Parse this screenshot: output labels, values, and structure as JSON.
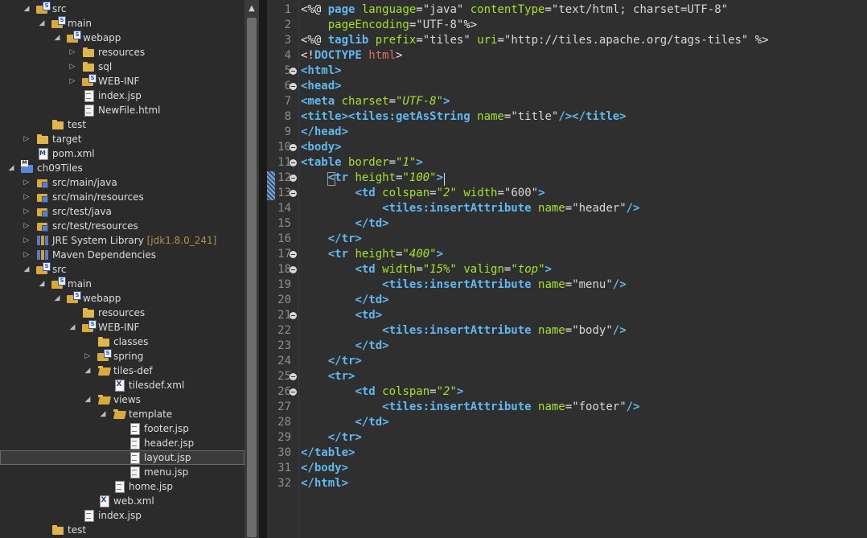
{
  "explorer": {
    "nodes": [
      {
        "label": "src",
        "depth": 1,
        "twisty": "open",
        "icon": "pkgfolder"
      },
      {
        "label": "main",
        "depth": 2,
        "twisty": "open",
        "icon": "pkgfolder"
      },
      {
        "label": "webapp",
        "depth": 3,
        "twisty": "open",
        "icon": "pkgfolder"
      },
      {
        "label": "resources",
        "depth": 4,
        "twisty": "closed",
        "icon": "folder"
      },
      {
        "label": "sql",
        "depth": 4,
        "twisty": "closed",
        "icon": "folder"
      },
      {
        "label": "WEB-INF",
        "depth": 4,
        "twisty": "closed",
        "icon": "pkgfolder"
      },
      {
        "label": "index.jsp",
        "depth": 4,
        "twisty": "none",
        "icon": "file"
      },
      {
        "label": "NewFile.html",
        "depth": 4,
        "twisty": "none",
        "icon": "file"
      },
      {
        "label": "test",
        "depth": 2,
        "twisty": "none",
        "icon": "folder"
      },
      {
        "label": "target",
        "depth": 1,
        "twisty": "closed",
        "icon": "folder"
      },
      {
        "label": "pom.xml",
        "depth": 1,
        "twisty": "none",
        "icon": "mvnfile"
      },
      {
        "label": "ch09Tiles",
        "depth": 0,
        "twisty": "open",
        "icon": "project"
      },
      {
        "label": "src/main/java",
        "depth": 1,
        "twisty": "closed",
        "icon": "srcfolder"
      },
      {
        "label": "src/main/resources",
        "depth": 1,
        "twisty": "closed",
        "icon": "srcfolder"
      },
      {
        "label": "src/test/java",
        "depth": 1,
        "twisty": "closed",
        "icon": "srcfolder"
      },
      {
        "label": "src/test/resources",
        "depth": 1,
        "twisty": "closed",
        "icon": "srcfolder"
      },
      {
        "label": "JRE System Library",
        "decoration": "[jdk1.8.0_241]",
        "depth": 1,
        "twisty": "closed",
        "icon": "jarlib"
      },
      {
        "label": "Maven Dependencies",
        "depth": 1,
        "twisty": "closed",
        "icon": "jarlib"
      },
      {
        "label": "src",
        "depth": 1,
        "twisty": "open",
        "icon": "pkgfolder"
      },
      {
        "label": "main",
        "depth": 2,
        "twisty": "open",
        "icon": "pkgfolder"
      },
      {
        "label": "webapp",
        "depth": 3,
        "twisty": "open",
        "icon": "pkgfolder"
      },
      {
        "label": "resources",
        "depth": 4,
        "twisty": "none",
        "icon": "folder"
      },
      {
        "label": "WEB-INF",
        "depth": 4,
        "twisty": "open",
        "icon": "pkgfolder"
      },
      {
        "label": "classes",
        "depth": 5,
        "twisty": "none",
        "icon": "folder"
      },
      {
        "label": "spring",
        "depth": 5,
        "twisty": "closed",
        "icon": "pkgfolder"
      },
      {
        "label": "tiles-def",
        "depth": 5,
        "twisty": "open",
        "icon": "folder"
      },
      {
        "label": "tilesdef.xml",
        "depth": 6,
        "twisty": "none",
        "icon": "xmlfile"
      },
      {
        "label": "views",
        "depth": 5,
        "twisty": "open",
        "icon": "folder"
      },
      {
        "label": "template",
        "depth": 6,
        "twisty": "open",
        "icon": "folder"
      },
      {
        "label": "footer.jsp",
        "depth": 7,
        "twisty": "none",
        "icon": "file"
      },
      {
        "label": "header.jsp",
        "depth": 7,
        "twisty": "none",
        "icon": "file"
      },
      {
        "label": "layout.jsp",
        "depth": 7,
        "twisty": "none",
        "icon": "file",
        "selected": true
      },
      {
        "label": "menu.jsp",
        "depth": 7,
        "twisty": "none",
        "icon": "file"
      },
      {
        "label": "home.jsp",
        "depth": 6,
        "twisty": "none",
        "icon": "file"
      },
      {
        "label": "web.xml",
        "depth": 5,
        "twisty": "none",
        "icon": "xmlfile"
      },
      {
        "label": "index.jsp",
        "depth": 4,
        "twisty": "none",
        "icon": "file"
      },
      {
        "label": "test",
        "depth": 2,
        "twisty": "none",
        "icon": "folder"
      }
    ]
  },
  "editor": {
    "lines": [
      {
        "n": "1",
        "fold": false,
        "tokens": [
          [
            "dir",
            "<%@ "
          ],
          [
            "tag",
            "page"
          ],
          [
            "attr",
            " language"
          ],
          [
            "punc",
            "="
          ],
          [
            "str",
            "\"java\""
          ],
          [
            "attr",
            " contentType"
          ],
          [
            "punc",
            "="
          ],
          [
            "str",
            "\"text/html; charset=UTF-8\""
          ]
        ]
      },
      {
        "n": "2",
        "fold": false,
        "tokens": [
          [
            "attr",
            "    pageEncoding"
          ],
          [
            "punc",
            "="
          ],
          [
            "str",
            "\"UTF-8\""
          ],
          [
            "pct",
            "%>"
          ]
        ]
      },
      {
        "n": "3",
        "fold": false,
        "tokens": [
          [
            "dir",
            "<%@ "
          ],
          [
            "tag",
            "taglib"
          ],
          [
            "attr",
            " prefix"
          ],
          [
            "punc",
            "="
          ],
          [
            "str",
            "\"tiles\""
          ],
          [
            "attr",
            " uri"
          ],
          [
            "punc",
            "="
          ],
          [
            "str",
            "\"http://tiles.apache.org/tags-tiles\""
          ],
          [
            "pct",
            " %>"
          ]
        ]
      },
      {
        "n": "4",
        "fold": false,
        "tokens": [
          [
            "doc",
            "<!"
          ],
          [
            "tag",
            "DOCTYPE"
          ],
          [
            "docname",
            " html"
          ],
          [
            "doc",
            ">"
          ]
        ]
      },
      {
        "n": "5",
        "fold": true,
        "tokens": [
          [
            "tag",
            "<html>"
          ]
        ]
      },
      {
        "n": "6",
        "fold": true,
        "tokens": [
          [
            "tag",
            "<head>"
          ]
        ]
      },
      {
        "n": "7",
        "fold": false,
        "tokens": [
          [
            "tag",
            "<meta"
          ],
          [
            "attr",
            " charset"
          ],
          [
            "punc",
            "="
          ],
          [
            "ival",
            "\"UTF-8\""
          ],
          [
            "tag",
            ">"
          ]
        ]
      },
      {
        "n": "8",
        "fold": false,
        "tokens": [
          [
            "tag",
            "<title><tiles:getAsString"
          ],
          [
            "attr",
            " name"
          ],
          [
            "punc",
            "="
          ],
          [
            "str",
            "\"title\""
          ],
          [
            "tag",
            "/></title>"
          ]
        ]
      },
      {
        "n": "9",
        "fold": false,
        "tokens": [
          [
            "tag",
            "</head>"
          ]
        ]
      },
      {
        "n": "10",
        "fold": true,
        "tokens": [
          [
            "tag",
            "<body>"
          ]
        ]
      },
      {
        "n": "11",
        "fold": true,
        "tokens": [
          [
            "tag",
            "<table"
          ],
          [
            "attr",
            " border"
          ],
          [
            "punc",
            "="
          ],
          [
            "ival",
            "\"1\""
          ],
          [
            "tag",
            ">"
          ]
        ]
      },
      {
        "n": "12",
        "fold": true,
        "tokens": [
          [
            "plain",
            "    "
          ],
          [
            "tag",
            "<tr"
          ],
          [
            "attr",
            " height"
          ],
          [
            "punc",
            "="
          ],
          [
            "ival",
            "\"100\""
          ],
          [
            "tag",
            ">"
          ]
        ]
      },
      {
        "n": "13",
        "fold": true,
        "tokens": [
          [
            "plain",
            "        "
          ],
          [
            "tag",
            "<td"
          ],
          [
            "attr",
            " colspan"
          ],
          [
            "punc",
            "="
          ],
          [
            "ival",
            "\"2\""
          ],
          [
            "attr",
            " width"
          ],
          [
            "punc",
            "="
          ],
          [
            "str",
            "\"600\""
          ],
          [
            "tag",
            ">"
          ]
        ]
      },
      {
        "n": "14",
        "fold": false,
        "tokens": [
          [
            "plain",
            "            "
          ],
          [
            "tag",
            "<tiles:insertAttribute"
          ],
          [
            "attr",
            " name"
          ],
          [
            "punc",
            "="
          ],
          [
            "str",
            "\"header\""
          ],
          [
            "tag",
            "/>"
          ]
        ]
      },
      {
        "n": "15",
        "fold": false,
        "tokens": [
          [
            "plain",
            "        "
          ],
          [
            "tag",
            "</td>"
          ]
        ]
      },
      {
        "n": "16",
        "fold": false,
        "tokens": [
          [
            "plain",
            "    "
          ],
          [
            "tag",
            "</tr>"
          ]
        ]
      },
      {
        "n": "17",
        "fold": true,
        "tokens": [
          [
            "plain",
            "    "
          ],
          [
            "tag",
            "<tr"
          ],
          [
            "attr",
            " height"
          ],
          [
            "punc",
            "="
          ],
          [
            "ival",
            "\"400\""
          ],
          [
            "tag",
            ">"
          ]
        ]
      },
      {
        "n": "18",
        "fold": true,
        "tokens": [
          [
            "plain",
            "        "
          ],
          [
            "tag",
            "<td"
          ],
          [
            "attr",
            " width"
          ],
          [
            "punc",
            "="
          ],
          [
            "ival",
            "\"15%\""
          ],
          [
            "attr",
            " valign"
          ],
          [
            "punc",
            "="
          ],
          [
            "ival",
            "\"top\""
          ],
          [
            "tag",
            ">"
          ]
        ]
      },
      {
        "n": "19",
        "fold": false,
        "tokens": [
          [
            "plain",
            "            "
          ],
          [
            "tag",
            "<tiles:insertAttribute"
          ],
          [
            "attr",
            " name"
          ],
          [
            "punc",
            "="
          ],
          [
            "str",
            "\"menu\""
          ],
          [
            "tag",
            "/>"
          ]
        ]
      },
      {
        "n": "20",
        "fold": false,
        "tokens": [
          [
            "plain",
            "        "
          ],
          [
            "tag",
            "</td>"
          ]
        ]
      },
      {
        "n": "21",
        "fold": true,
        "tokens": [
          [
            "plain",
            "        "
          ],
          [
            "tag",
            "<td>"
          ]
        ]
      },
      {
        "n": "22",
        "fold": false,
        "tokens": [
          [
            "plain",
            "            "
          ],
          [
            "tag",
            "<tiles:insertAttribute"
          ],
          [
            "attr",
            " name"
          ],
          [
            "punc",
            "="
          ],
          [
            "str",
            "\"body\""
          ],
          [
            "tag",
            "/>"
          ]
        ]
      },
      {
        "n": "23",
        "fold": false,
        "tokens": [
          [
            "plain",
            "        "
          ],
          [
            "tag",
            "</td>"
          ]
        ]
      },
      {
        "n": "24",
        "fold": false,
        "tokens": [
          [
            "plain",
            "    "
          ],
          [
            "tag",
            "</tr>"
          ]
        ]
      },
      {
        "n": "25",
        "fold": true,
        "tokens": [
          [
            "plain",
            "    "
          ],
          [
            "tag",
            "<tr>"
          ]
        ]
      },
      {
        "n": "26",
        "fold": true,
        "tokens": [
          [
            "plain",
            "        "
          ],
          [
            "tag",
            "<td"
          ],
          [
            "attr",
            " colspan"
          ],
          [
            "punc",
            "="
          ],
          [
            "ival",
            "\"2\""
          ],
          [
            "tag",
            ">"
          ]
        ]
      },
      {
        "n": "27",
        "fold": false,
        "tokens": [
          [
            "plain",
            "            "
          ],
          [
            "tag",
            "<tiles:insertAttribute"
          ],
          [
            "attr",
            " name"
          ],
          [
            "punc",
            "="
          ],
          [
            "str",
            "\"footer\""
          ],
          [
            "tag",
            "/>"
          ]
        ]
      },
      {
        "n": "28",
        "fold": false,
        "tokens": [
          [
            "plain",
            "        "
          ],
          [
            "tag",
            "</td>"
          ]
        ]
      },
      {
        "n": "29",
        "fold": false,
        "tokens": [
          [
            "plain",
            "    "
          ],
          [
            "tag",
            "</tr>"
          ]
        ]
      },
      {
        "n": "30",
        "fold": false,
        "tokens": [
          [
            "tag",
            "</table>"
          ]
        ]
      },
      {
        "n": "31",
        "fold": false,
        "tokens": [
          [
            "tag",
            "</body>"
          ]
        ]
      },
      {
        "n": "32",
        "fold": false,
        "tokens": [
          [
            "tag",
            "</html>"
          ]
        ]
      }
    ]
  },
  "colors": {
    "explorer_bg": "#2b2b2b",
    "editor_bg": "#2f2f2f",
    "tag": "#5fb8f0",
    "attribute": "#a6e22e",
    "line_number": "#8e8e8e"
  }
}
